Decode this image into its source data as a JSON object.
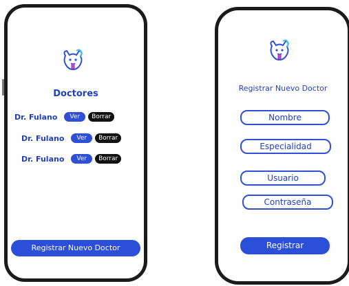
{
  "doctors_screen": {
    "title": "Doctores",
    "doctors": [
      {
        "name": "Dr. Fulano",
        "view_label": "Ver",
        "delete_label": "Borrar"
      },
      {
        "name": "Dr. Fulano",
        "view_label": "Ver",
        "delete_label": "Borrar"
      },
      {
        "name": "Dr. Fulano",
        "view_label": "Ver",
        "delete_label": "Borrar"
      }
    ],
    "register_button": "Registrar Nuevo Doctor"
  },
  "register_screen": {
    "title": "Registrar  Nuevo Doctor",
    "fields": {
      "name": "Nombre",
      "specialty": "Especialidad",
      "user": "Usuario",
      "password": "Contraseña"
    },
    "submit_button": "Registrar"
  },
  "colors": {
    "accent": "#2e4fd6",
    "text_blue": "#1f3fbf",
    "frame": "#1b1b1b",
    "delete_button": "#111111"
  },
  "icons": {
    "logo": "dog-logo-icon"
  }
}
